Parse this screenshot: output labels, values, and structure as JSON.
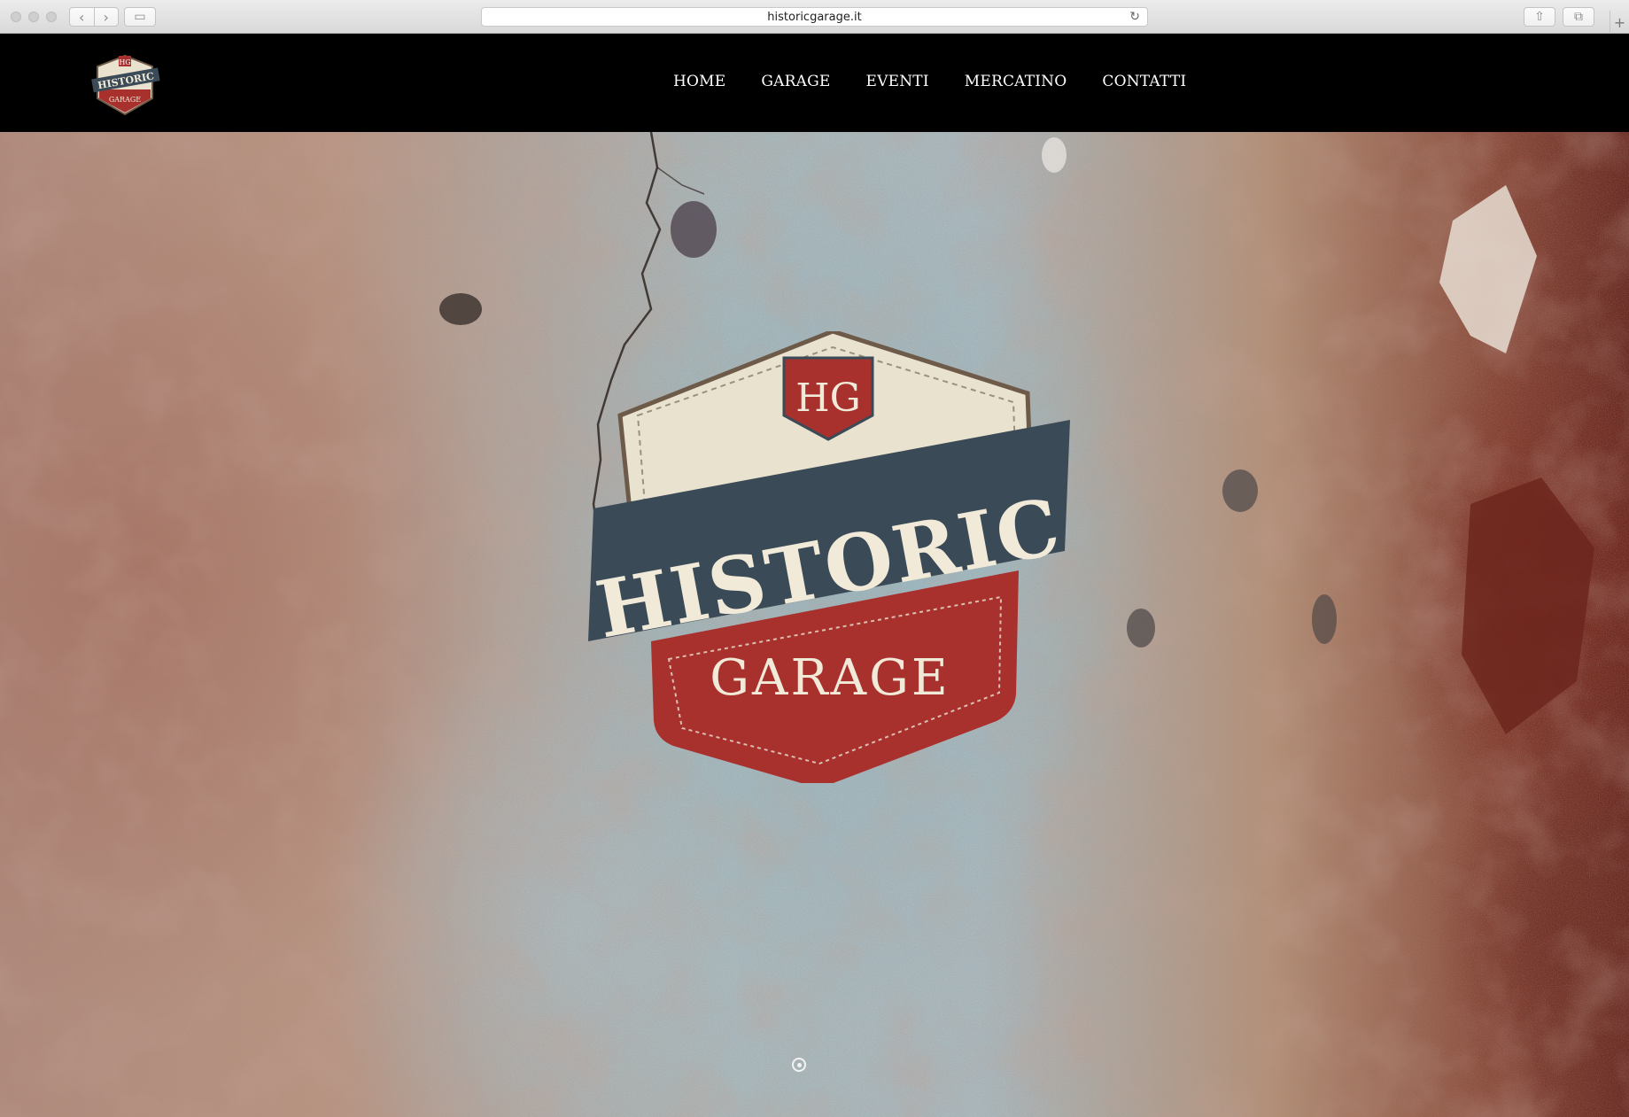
{
  "browser": {
    "url": "historicgarage.it",
    "icons": [
      "back-icon",
      "forward-icon",
      "sidebar-icon",
      "reload-icon",
      "share-icon",
      "tabs-icon",
      "new-tab-icon"
    ]
  },
  "header": {
    "logo": {
      "top": "HG",
      "middle": "HISTORIC",
      "bottom": "GARAGE"
    },
    "nav": [
      "HOME",
      "GARAGE",
      "EVENTI",
      "MERCATINO",
      "CONTATTI"
    ]
  },
  "hero": {
    "logo": {
      "monogram": "HG",
      "banner": "HISTORIC",
      "shield": "GARAGE"
    },
    "colors": {
      "red": "#a8312e",
      "navy": "#3b4a57",
      "cream": "#e9e2cf"
    }
  }
}
